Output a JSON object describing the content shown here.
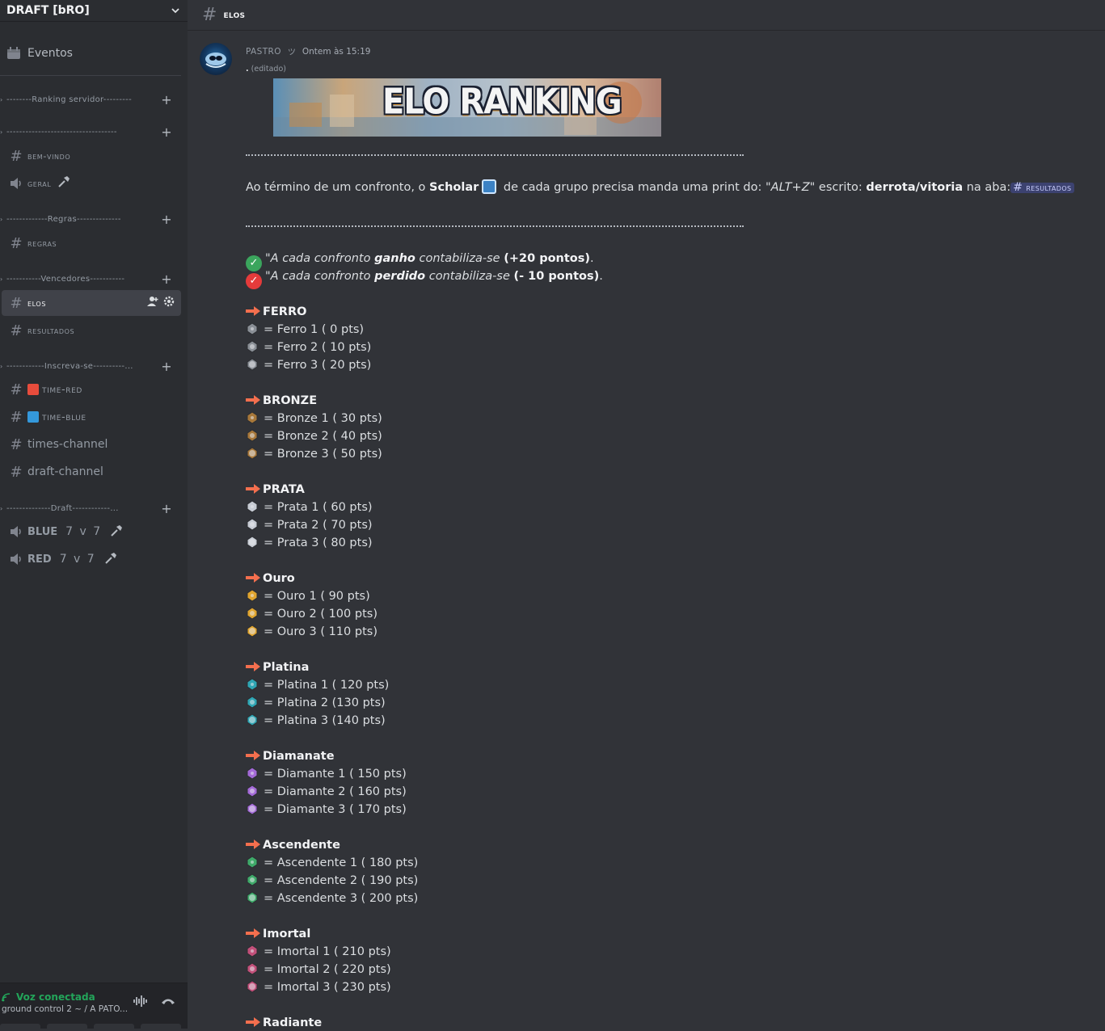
{
  "server": {
    "name": "DRAFT [bRO]"
  },
  "sidebar": {
    "events_label": "Eventos",
    "categories": [
      {
        "label": "--------Ranking servidor---------"
      },
      {
        "label": "-----------------------------------"
      },
      {
        "label": "-------------Regras--------------"
      },
      {
        "label": "-----------Vencedores-----------"
      },
      {
        "label": "------------Inscreva-se----------..."
      },
      {
        "label": "--------------Draft------------..."
      }
    ],
    "channels": {
      "bem_vindo": "bem-vindo",
      "geral": "geral",
      "regras": "regras",
      "elos": "elos",
      "resultados": "resultados",
      "time_red": "time-red",
      "time_blue": "time-blue",
      "times_channel": "times-channel",
      "draft_channel": "draft-channel",
      "blue": "BLUE",
      "blue_count": "7 v 7",
      "red": "RED",
      "red_count": "7 v 7"
    },
    "voice": {
      "status": "Voz conectada",
      "sub": "ground control 2 ~ / A PATO..."
    }
  },
  "topbar": {
    "channel": "elos"
  },
  "message": {
    "author": "PASTRO",
    "timestamp": "Ontem às 15:19",
    "first_line": ".",
    "edited": "(editado)",
    "banner_title": "ELO RANKING",
    "intro": {
      "p1": "Ao término de um confronto, o ",
      "scholar": "Scholar",
      "p2": " de cada grupo precisa manda uma print do: ",
      "altz": "\"ALT+Z\"",
      "p3": " escrito: ",
      "dv": "derrota/vitoria",
      "p4": " na aba:",
      "mention": "resultados"
    },
    "rule_win": {
      "p1": "\"A cada confronto ",
      "b1": "ganho",
      "p2": " contabiliza-se ",
      "b2": "(+20 pontos)",
      "p3": "."
    },
    "rule_loss": {
      "p1": "\"A cada confronto ",
      "b1": "perdido",
      "p2": " contabiliza-se ",
      "b2": "(- 10 pontos)",
      "p3": "."
    },
    "tiers": [
      {
        "name": "FERRO",
        "color": "#8a8f96",
        "ranks": [
          "= Ferro 1  ( 0 pts)",
          "= Ferro 2 ( 10 pts)",
          "= Ferro 3 ( 20 pts)"
        ]
      },
      {
        "name": "BRONZE",
        "color": "#a8783a",
        "ranks": [
          "= Bronze 1 ( 30 pts)",
          "= Bronze 2 ( 40 pts)",
          "= Bronze 3 ( 50 pts)"
        ]
      },
      {
        "name": "PRATA",
        "color": "#c7ccd4",
        "ranks": [
          "= Prata 1 ( 60 pts)",
          "= Prata 2 ( 70 pts)",
          "= Prata 3 ( 80 pts)"
        ]
      },
      {
        "name": "Ouro",
        "color": "#e0a52f",
        "ranks": [
          "= Ouro 1 ( 90 pts)",
          "= Ouro 2 ( 100 pts)",
          "= Ouro 3 ( 110 pts)"
        ]
      },
      {
        "name": "Platina",
        "color": "#2fa6b4",
        "ranks": [
          "= Platina 1 ( 120 pts)",
          "= Platina 2 (130 pts)",
          "= Platina 3 (140 pts)"
        ]
      },
      {
        "name": "Diamanate",
        "color": "#a46ad8",
        "ranks": [
          "= Diamante 1 ( 150 pts)",
          "= Diamante 2 ( 160 pts)",
          "= Diamante 3 ( 170 pts)"
        ]
      },
      {
        "name": "Ascendente",
        "color": "#3faa6a",
        "ranks": [
          "= Ascendente 1 ( 180 pts)",
          "= Ascendente 2 ( 190 pts)",
          "= Ascendente 3 ( 200 pts)"
        ]
      },
      {
        "name": "Imortal",
        "color": "#c2507a",
        "ranks": [
          "= Imortal 1 (  210 pts)",
          "= Imortal 2 ( 220 pts)",
          "= Imortal 3 ( 230 pts)"
        ]
      },
      {
        "name": "Radiante",
        "color": "#f0d060",
        "ranks": []
      }
    ],
    "colors": {
      "arrow": "#f46f4e",
      "check_win": "#3ba55d",
      "check_loss": "#e53b3b"
    }
  }
}
